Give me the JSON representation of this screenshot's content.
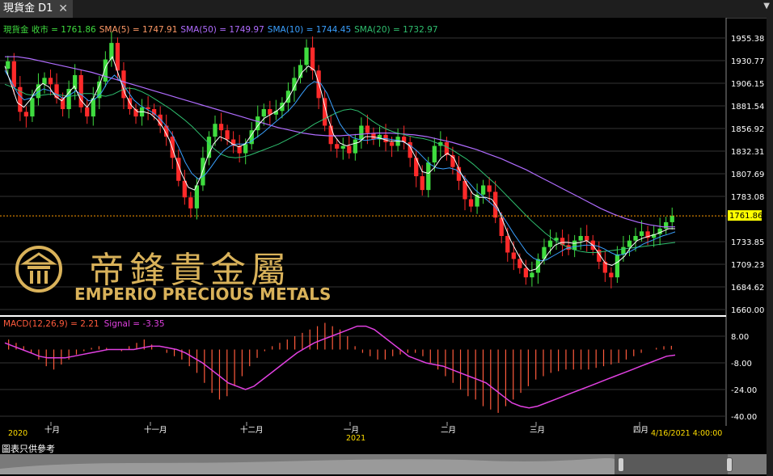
{
  "tab": {
    "title": "現貨金 D1",
    "close": "✕"
  },
  "legend": [
    {
      "label": "現貨金 收市 = 1761.86",
      "color": "#3fdc3f"
    },
    {
      "label": "SMA(5) = 1747.91",
      "color": "#ff9966"
    },
    {
      "label": "SMA(50) = 1749.97",
      "color": "#b06cff"
    },
    {
      "label": "SMA(10) = 1744.45",
      "color": "#3aa0ff"
    },
    {
      "label": "SMA(20) = 1732.97",
      "color": "#2fbf6f"
    }
  ],
  "macd_legend": [
    {
      "label": "MACD(12,26,9) = 2.21",
      "color": "#ff5a3c"
    },
    {
      "label": "Signal = -3.35",
      "color": "#e040e0"
    }
  ],
  "logo": {
    "cn": "帝鋒貴金屬",
    "en": "EMPERIO PRECIOUS METALS"
  },
  "disclaimer": "圖表只供參考",
  "colors": {
    "up": "#3fdc3f",
    "down": "#ff2a2a",
    "current": "#ffff00",
    "gold": "#d9b25a"
  },
  "chart_data": [
    {
      "type": "candlestick",
      "title": "現貨金 D1",
      "ylim": [
        1660,
        1960
      ],
      "yticks": [
        1955.38,
        1930.77,
        1906.15,
        1881.54,
        1856.92,
        1832.31,
        1807.69,
        1783.08,
        1733.85,
        1709.23,
        1684.62,
        1660.0
      ],
      "current_price": 1761.86,
      "current_label": "1761.86",
      "x_labels": [
        "2020",
        "十月",
        "十一月",
        "十二月",
        "一月",
        "2021",
        "二月",
        "三月",
        "四月",
        "4/16/2021 4:00:00"
      ],
      "close_path": [
        1930,
        1902,
        1875,
        1870,
        1890,
        1905,
        1912,
        1905,
        1890,
        1878,
        1900,
        1915,
        1880,
        1870,
        1890,
        1908,
        1932,
        1950,
        1920,
        1890,
        1878,
        1870,
        1880,
        1878,
        1872,
        1860,
        1848,
        1825,
        1800,
        1782,
        1770,
        1795,
        1825,
        1848,
        1862,
        1855,
        1845,
        1838,
        1830,
        1840,
        1855,
        1870,
        1878,
        1872,
        1876,
        1885,
        1898,
        1912,
        1926,
        1945,
        1920,
        1890,
        1860,
        1840,
        1835,
        1838,
        1830,
        1845,
        1860,
        1852,
        1845,
        1850,
        1842,
        1838,
        1848,
        1842,
        1825,
        1805,
        1790,
        1820,
        1838,
        1842,
        1828,
        1815,
        1800,
        1780,
        1772,
        1785,
        1795,
        1788,
        1760,
        1740,
        1722,
        1715,
        1705,
        1695,
        1700,
        1715,
        1728,
        1735,
        1738,
        1730,
        1725,
        1735,
        1740,
        1735,
        1725,
        1712,
        1700,
        1695,
        1720,
        1728,
        1735,
        1740,
        1745,
        1738,
        1742,
        1748,
        1755,
        1761.86
      ],
      "sma5_path": [
        1925,
        1905,
        1885,
        1880,
        1888,
        1900,
        1906,
        1902,
        1892,
        1887,
        1895,
        1903,
        1888,
        1880,
        1890,
        1905,
        1925,
        1935,
        1915,
        1895,
        1882,
        1875,
        1875,
        1873,
        1867,
        1858,
        1845,
        1825,
        1807,
        1793,
        1790,
        1805,
        1825,
        1840,
        1848,
        1845,
        1840,
        1837,
        1840,
        1850,
        1860,
        1868,
        1872,
        1876,
        1882,
        1892,
        1905,
        1918,
        1925,
        1920,
        1898,
        1870,
        1850,
        1841,
        1838,
        1840,
        1842,
        1848,
        1848,
        1847,
        1845,
        1843,
        1843,
        1843,
        1838,
        1825,
        1810,
        1808,
        1815,
        1825,
        1830,
        1825,
        1810,
        1797,
        1786,
        1782,
        1782,
        1780,
        1770,
        1752,
        1735,
        1722,
        1710,
        1702,
        1704,
        1712,
        1722,
        1730,
        1733,
        1733,
        1732,
        1733,
        1735,
        1730,
        1720,
        1710,
        1708,
        1712,
        1718,
        1728,
        1735,
        1738,
        1740,
        1742,
        1745,
        1748,
        1747.91
      ],
      "sma10_path": [
        1920,
        1908,
        1895,
        1888,
        1890,
        1896,
        1900,
        1898,
        1894,
        1890,
        1893,
        1898,
        1893,
        1887,
        1889,
        1896,
        1908,
        1915,
        1908,
        1898,
        1888,
        1882,
        1878,
        1874,
        1868,
        1860,
        1850,
        1836,
        1820,
        1808,
        1802,
        1806,
        1815,
        1825,
        1833,
        1838,
        1840,
        1840,
        1842,
        1847,
        1852,
        1858,
        1864,
        1870,
        1876,
        1884,
        1894,
        1903,
        1908,
        1906,
        1895,
        1878,
        1862,
        1852,
        1847,
        1845,
        1844,
        1845,
        1846,
        1846,
        1845,
        1844,
        1842,
        1838,
        1832,
        1825,
        1818,
        1814,
        1813,
        1814,
        1812,
        1806,
        1798,
        1790,
        1784,
        1778,
        1772,
        1764,
        1753,
        1742,
        1732,
        1722,
        1716,
        1713,
        1714,
        1718,
        1722,
        1726,
        1728,
        1729,
        1730,
        1730,
        1729,
        1726,
        1722,
        1719,
        1720,
        1723,
        1727,
        1731,
        1734,
        1737,
        1740,
        1742,
        1744.45
      ],
      "sma20_path": [
        1905,
        1902,
        1898,
        1894,
        1893,
        1893,
        1894,
        1894,
        1893,
        1892,
        1893,
        1895,
        1895,
        1893,
        1892,
        1894,
        1898,
        1901,
        1900,
        1897,
        1893,
        1888,
        1883,
        1878,
        1872,
        1866,
        1859,
        1851,
        1843,
        1835,
        1829,
        1826,
        1825,
        1826,
        1828,
        1831,
        1834,
        1837,
        1840,
        1844,
        1848,
        1852,
        1857,
        1862,
        1866,
        1870,
        1874,
        1877,
        1878,
        1876,
        1871,
        1865,
        1860,
        1856,
        1853,
        1851,
        1849,
        1847,
        1846,
        1844,
        1841,
        1838,
        1834,
        1829,
        1824,
        1818,
        1811,
        1804,
        1797,
        1789,
        1781,
        1773,
        1765,
        1757,
        1750,
        1743,
        1737,
        1732,
        1728,
        1725,
        1723,
        1722,
        1722,
        1723,
        1724,
        1725,
        1726,
        1727,
        1728,
        1729,
        1730,
        1731,
        1732,
        1732.97
      ],
      "sma50_path": [
        1935,
        1935,
        1933,
        1930,
        1927,
        1924,
        1921,
        1918,
        1914,
        1910,
        1906,
        1902,
        1898,
        1894,
        1890,
        1886,
        1882,
        1878,
        1874,
        1870,
        1866,
        1862,
        1858,
        1855,
        1852,
        1850,
        1849,
        1849,
        1850,
        1851,
        1852,
        1852,
        1851,
        1850,
        1848,
        1845,
        1842,
        1838,
        1834,
        1829,
        1824,
        1818,
        1812,
        1805,
        1798,
        1791,
        1784,
        1777,
        1770,
        1764,
        1759,
        1755,
        1752,
        1750,
        1749.97
      ]
    },
    {
      "type": "bar",
      "title": "MACD(12,26,9)",
      "ylim": [
        -44,
        16
      ],
      "yticks": [
        8.0,
        -8.0,
        -24.0,
        -40.0
      ],
      "macd_values": [
        6,
        4,
        2,
        -2,
        -6,
        -10,
        -12,
        -9,
        -6,
        -3,
        -1,
        1,
        2,
        1,
        0,
        -1,
        2,
        4,
        6,
        3,
        0,
        -2,
        -4,
        -6,
        -10,
        -14,
        -20,
        -26,
        -30,
        -28,
        -22,
        -16,
        -10,
        -5,
        -1,
        2,
        4,
        6,
        8,
        10,
        12,
        14,
        16,
        14,
        12,
        8,
        2,
        -2,
        -4,
        -6,
        -6,
        -4,
        -3,
        -2,
        -2,
        -4,
        -8,
        -12,
        -16,
        -20,
        -24,
        -28,
        -30,
        -34,
        -36,
        -38,
        -34,
        -30,
        -26,
        -22,
        -18,
        -16,
        -14,
        -13,
        -12,
        -12,
        -12,
        -12,
        -11,
        -10,
        -9,
        -8,
        -6,
        -4,
        -2,
        0,
        1,
        2,
        2.21
      ],
      "signal_values": [
        4,
        2,
        0,
        -2,
        -4,
        -5,
        -5,
        -5,
        -4,
        -3,
        -2,
        -1,
        0,
        0,
        0,
        0,
        1,
        2,
        2,
        1,
        0,
        -2,
        -5,
        -8,
        -12,
        -16,
        -20,
        -22,
        -24,
        -22,
        -18,
        -14,
        -10,
        -6,
        -2,
        1,
        4,
        6,
        8,
        10,
        12,
        14,
        14,
        12,
        8,
        4,
        0,
        -4,
        -6,
        -8,
        -9,
        -10,
        -12,
        -14,
        -16,
        -18,
        -20,
        -24,
        -28,
        -32,
        -34,
        -35,
        -34,
        -32,
        -30,
        -28,
        -26,
        -24,
        -22,
        -20,
        -18,
        -16,
        -14,
        -12,
        -10,
        -8,
        -6,
        -4,
        -3.35
      ]
    }
  ]
}
